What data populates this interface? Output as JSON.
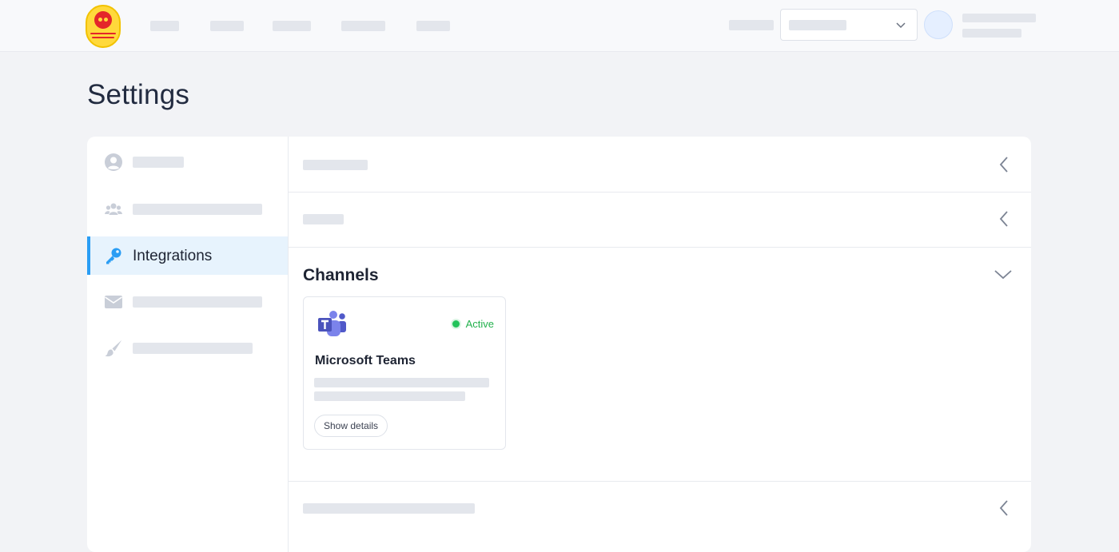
{
  "page": {
    "title": "Settings"
  },
  "sidebar": {
    "items": [
      {
        "label": "",
        "icon": "user-circle-icon"
      },
      {
        "label": "",
        "icon": "team-icon"
      },
      {
        "label": "Integrations",
        "icon": "key-icon",
        "active": true
      },
      {
        "label": "",
        "icon": "envelope-icon"
      },
      {
        "label": "",
        "icon": "brush-icon"
      }
    ]
  },
  "channels": {
    "title": "Channels",
    "integration": {
      "name": "Microsoft Teams",
      "status": "Active",
      "action_label": "Show details",
      "icon": "microsoft-teams-icon"
    }
  },
  "colors": {
    "accent": "#2a9df4",
    "active_status": "#22b14c",
    "teams_purple": "#5b5fc7"
  }
}
